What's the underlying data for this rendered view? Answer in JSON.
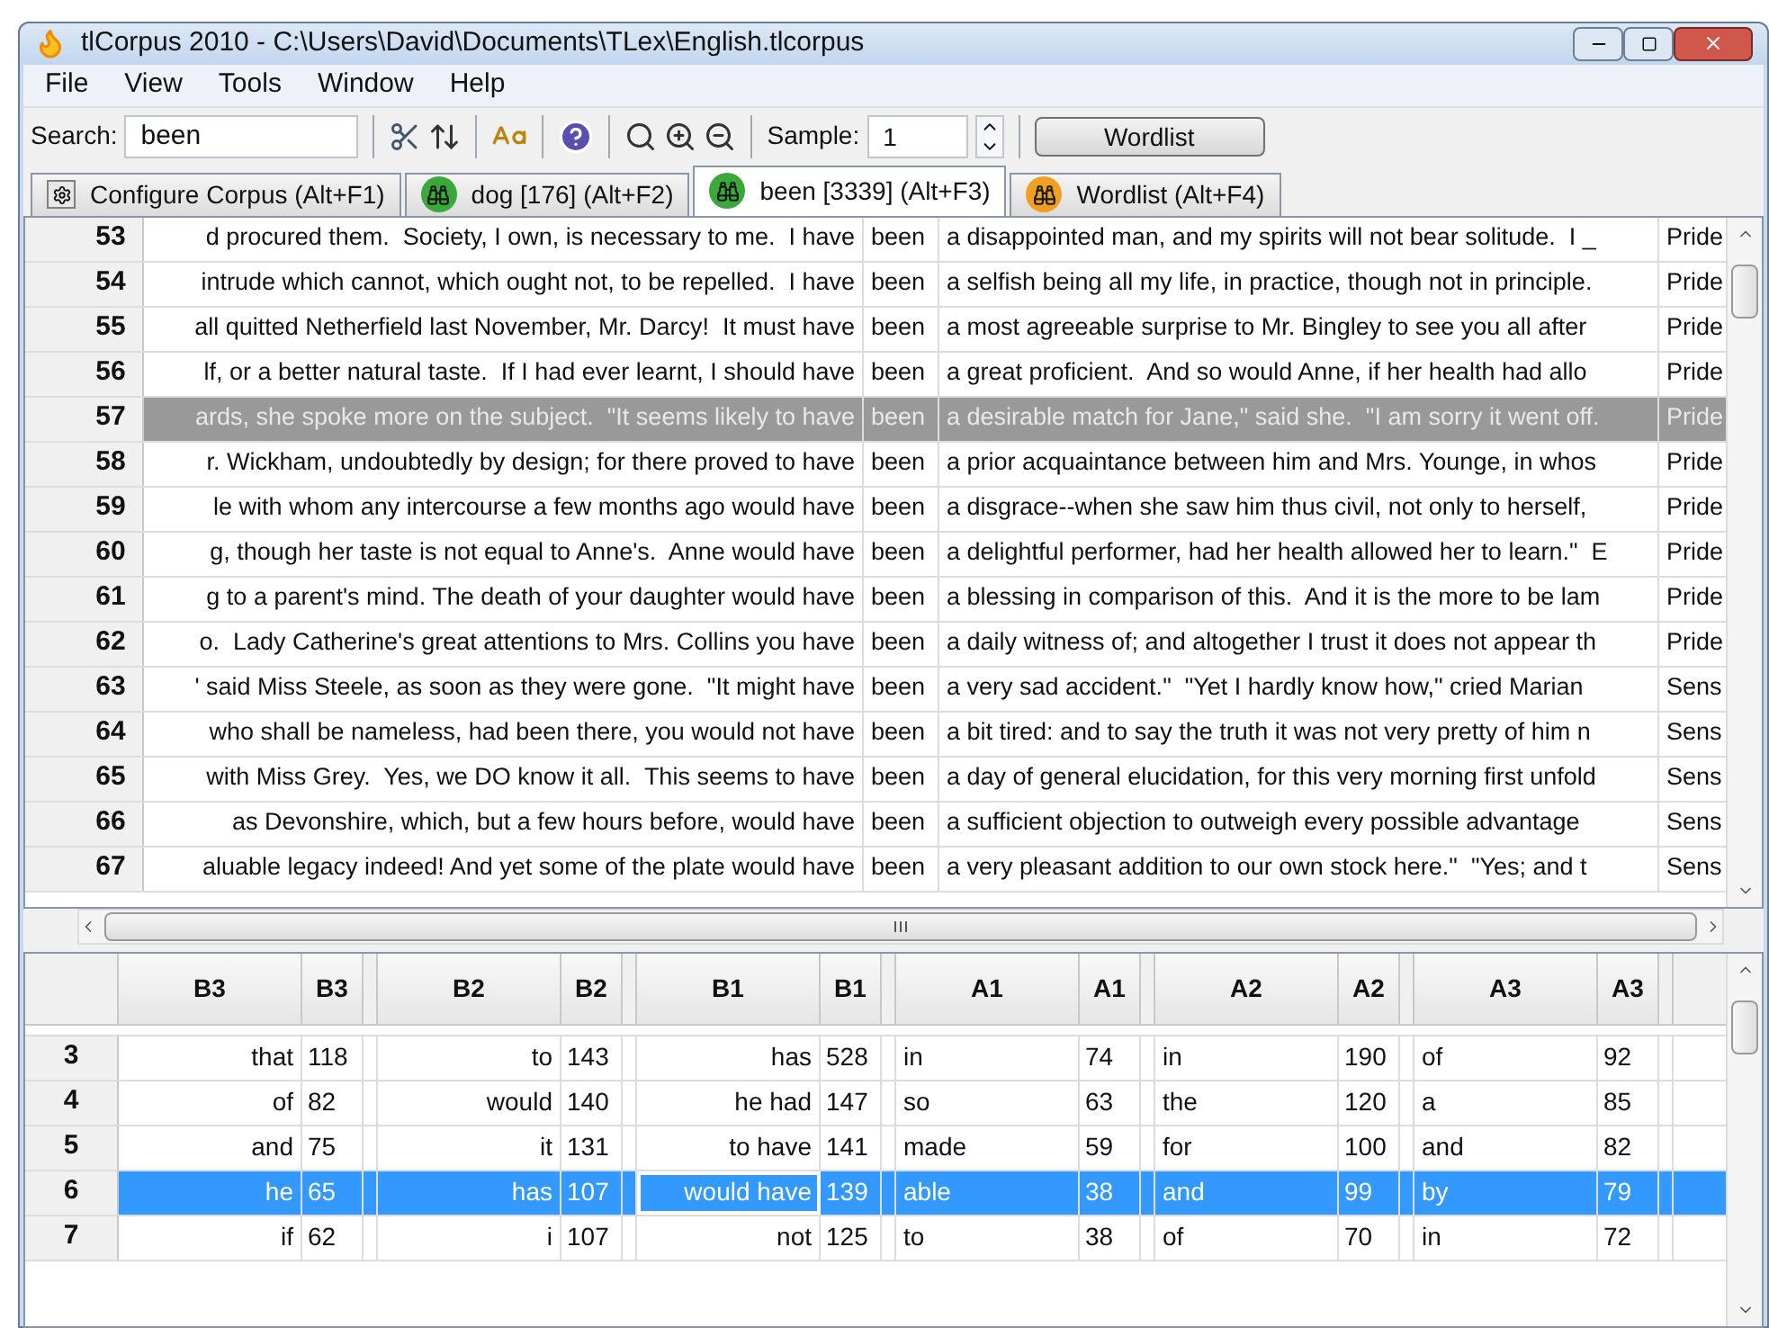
{
  "window": {
    "title": "tlCorpus 2010 - C:\\Users\\David\\Documents\\TLex\\English.tlcorpus"
  },
  "menu": [
    "File",
    "View",
    "Tools",
    "Window",
    "Help"
  ],
  "toolbar": {
    "search_label": "Search:",
    "search_value": "been",
    "sample_label": "Sample:",
    "sample_value": "1",
    "wordlist_button": "Wordlist"
  },
  "tabs": [
    {
      "label": "Configure Corpus (Alt+F1)",
      "kind": "config",
      "selected": false
    },
    {
      "label": "dog [176] (Alt+F2)",
      "kind": "search",
      "selected": false
    },
    {
      "label": "been [3339] (Alt+F3)",
      "kind": "search",
      "selected": true
    },
    {
      "label": "Wordlist (Alt+F4)",
      "kind": "wordlist",
      "selected": false
    }
  ],
  "concordance": {
    "rows": [
      {
        "num": "53",
        "left": "d procured them.  Society, I own, is necessary to me.  I have",
        "keyword": "been",
        "right": "a disappointed man, and my spirits will not bear solitude.  I _",
        "source": "Pride",
        "selected": false
      },
      {
        "num": "54",
        "left": "intrude which cannot, which ought not, to be repelled.  I have",
        "keyword": "been",
        "right": "a selfish being all my life, in practice, though not in principle.",
        "source": "Pride",
        "selected": false
      },
      {
        "num": "55",
        "left": "all quitted Netherfield last November, Mr. Darcy!  It must have",
        "keyword": "been",
        "right": "a most agreeable surprise to Mr. Bingley to see you all after",
        "source": "Pride",
        "selected": false
      },
      {
        "num": "56",
        "left": "lf, or a better natural taste.  If I had ever learnt, I should have",
        "keyword": "been",
        "right": "a great proficient.  And so would Anne, if her health had allo",
        "source": "Pride",
        "selected": false
      },
      {
        "num": "57",
        "left": "ards, she spoke more on the subject.  \"It seems likely to have",
        "keyword": "been",
        "right": "a desirable match for Jane,\" said she.  \"I am sorry it went off.",
        "source": "Pride",
        "selected": true
      },
      {
        "num": "58",
        "left": "r. Wickham, undoubtedly by design; for there proved to have",
        "keyword": "been",
        "right": "a prior acquaintance between him and Mrs. Younge, in whos",
        "source": "Pride",
        "selected": false
      },
      {
        "num": "59",
        "left": "le with whom any intercourse a few months ago would have",
        "keyword": "been",
        "right": "a disgrace--when she saw him thus civil, not only to herself,",
        "source": "Pride",
        "selected": false
      },
      {
        "num": "60",
        "left": "g, though her taste is not equal to Anne's.  Anne would have",
        "keyword": "been",
        "right": "a delightful performer, had her health allowed her to learn.\"  E",
        "source": "Pride",
        "selected": false
      },
      {
        "num": "61",
        "left": "g to a parent's mind. The death of your daughter would have",
        "keyword": "been",
        "right": "a blessing in comparison of this.  And it is the more to be lam",
        "source": "Pride",
        "selected": false
      },
      {
        "num": "62",
        "left": "o.  Lady Catherine's great attentions to Mrs. Collins you have",
        "keyword": "been",
        "right": "a daily witness of; and altogether I trust it does not appear th",
        "source": "Pride",
        "selected": false
      },
      {
        "num": "63",
        "left": "' said Miss Steele, as soon as they were gone.  \"It might have",
        "keyword": "been",
        "right": "a very sad accident.\"  \"Yet I hardly know how,\" cried Marian",
        "source": "Sens",
        "selected": false
      },
      {
        "num": "64",
        "left": "who shall be nameless, had been there, you would not have",
        "keyword": "been",
        "right": "a bit tired: and to say the truth it was not very pretty of him n",
        "source": "Sens",
        "selected": false
      },
      {
        "num": "65",
        "left": "with Miss Grey.  Yes, we DO know it all.  This seems to have",
        "keyword": "been",
        "right": "a day of general elucidation, for this very morning first unfold",
        "source": "Sens",
        "selected": false
      },
      {
        "num": "66",
        "left": "as Devonshire, which, but a few hours before, would have",
        "keyword": "been",
        "right": "a sufficient objection to outweigh every possible advantage",
        "source": "Sens",
        "selected": false
      },
      {
        "num": "67",
        "left": "aluable legacy indeed! And yet some of the plate would have",
        "keyword": "been",
        "right": "a very pleasant addition to our own stock here.\"  \"Yes; and t",
        "source": "Sens",
        "selected": false
      }
    ]
  },
  "collocations": {
    "columns": [
      {
        "kind": "before",
        "word": "B3",
        "count": "B3"
      },
      {
        "kind": "before",
        "word": "B2",
        "count": "B2"
      },
      {
        "kind": "before",
        "word": "B1",
        "count": "B1"
      },
      {
        "kind": "after",
        "word": "A1",
        "count": "A1"
      },
      {
        "kind": "after",
        "word": "A2",
        "count": "A2"
      },
      {
        "kind": "after",
        "word": "A3",
        "count": "A3"
      }
    ],
    "rows": [
      {
        "num": "3",
        "selected": false,
        "cells": [
          {
            "word": "that",
            "count": "118",
            "focused": false
          },
          {
            "word": "to",
            "count": "143",
            "focused": false
          },
          {
            "word": "has",
            "count": "528",
            "focused": false
          },
          {
            "word": "in",
            "count": "74",
            "focused": false
          },
          {
            "word": "in",
            "count": "190",
            "focused": false
          },
          {
            "word": "of",
            "count": "92",
            "focused": false
          }
        ]
      },
      {
        "num": "4",
        "selected": false,
        "cells": [
          {
            "word": "of",
            "count": "82",
            "focused": false
          },
          {
            "word": "would",
            "count": "140",
            "focused": false
          },
          {
            "word": "he had",
            "count": "147",
            "focused": false
          },
          {
            "word": "so",
            "count": "63",
            "focused": false
          },
          {
            "word": "the",
            "count": "120",
            "focused": false
          },
          {
            "word": "a",
            "count": "85",
            "focused": false
          }
        ]
      },
      {
        "num": "5",
        "selected": false,
        "cells": [
          {
            "word": "and",
            "count": "75",
            "focused": false
          },
          {
            "word": "it",
            "count": "131",
            "focused": false
          },
          {
            "word": "to have",
            "count": "141",
            "focused": false
          },
          {
            "word": "made",
            "count": "59",
            "focused": false
          },
          {
            "word": "for",
            "count": "100",
            "focused": false
          },
          {
            "word": "and",
            "count": "82",
            "focused": false
          }
        ]
      },
      {
        "num": "6",
        "selected": true,
        "cells": [
          {
            "word": "he",
            "count": "65",
            "focused": false
          },
          {
            "word": "has",
            "count": "107",
            "focused": false
          },
          {
            "word": "would have",
            "count": "139",
            "focused": true
          },
          {
            "word": "able",
            "count": "38",
            "focused": false
          },
          {
            "word": "and",
            "count": "99",
            "focused": false
          },
          {
            "word": "by",
            "count": "79",
            "focused": false
          }
        ]
      },
      {
        "num": "7",
        "selected": false,
        "cells": [
          {
            "word": "if",
            "count": "62",
            "focused": false
          },
          {
            "word": "i",
            "count": "107",
            "focused": false
          },
          {
            "word": "not",
            "count": "125",
            "focused": false
          },
          {
            "word": "to",
            "count": "38",
            "focused": false
          },
          {
            "word": "of",
            "count": "70",
            "focused": false
          },
          {
            "word": "in",
            "count": "72",
            "focused": false
          }
        ]
      }
    ]
  }
}
